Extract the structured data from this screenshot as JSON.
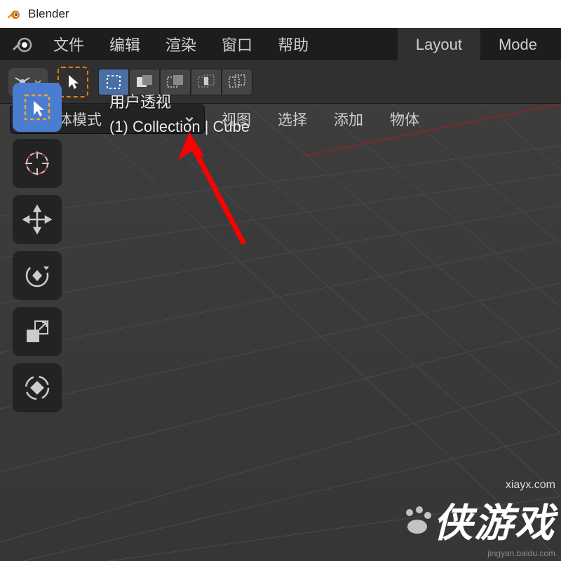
{
  "app": {
    "title": "Blender"
  },
  "menu": {
    "file": "文件",
    "edit": "编辑",
    "render": "渲染",
    "window": "窗口",
    "help": "帮助"
  },
  "tabs": {
    "layout": "Layout",
    "modeling": "Mode"
  },
  "mode_dropdown": {
    "label": "物体模式"
  },
  "viewport_menu": {
    "view": "视图",
    "select": "选择",
    "add": "添加",
    "object": "物体"
  },
  "overlay": {
    "perspective": "用户透视",
    "collection": "(1) Collection | Cube"
  },
  "watermark": {
    "url": "xiayx.com",
    "text": "侠游戏",
    "sub": "jingyan.baidu.com"
  },
  "colors": {
    "accent": "#e87d0d",
    "panel": "#303030",
    "dark": "#1d1d1d"
  }
}
